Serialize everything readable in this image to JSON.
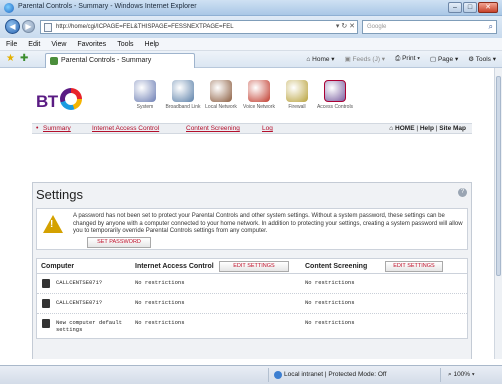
{
  "window": {
    "title": "Parental Controls - Summary - Windows Internet Explorer"
  },
  "addressbar": {
    "url": "http://home/cgi/ICPAGE=FEL&THISPAGE=FESSNEXTPAGE=FEL",
    "search_placeholder": "Google"
  },
  "menubar": [
    "File",
    "Edit",
    "View",
    "Favorites",
    "Tools",
    "Help"
  ],
  "tab": {
    "label": "Parental Controls - Summary"
  },
  "commandbar": {
    "home": "Home",
    "feeds": "Feeds (J)",
    "print": "Print",
    "page": "Page",
    "tools": "Tools"
  },
  "page": {
    "logo": "BT",
    "nav_icons": [
      {
        "label": "System",
        "color": "#6b7db3"
      },
      {
        "label": "Broadband Link",
        "color": "#5a7fa8"
      },
      {
        "label": "Local Network",
        "color": "#8a5b3d"
      },
      {
        "label": "Voice Network",
        "color": "#c0392b"
      },
      {
        "label": "Firewall",
        "color": "#b8a13a"
      },
      {
        "label": "Access Controls",
        "color": "#7a5fa0"
      }
    ],
    "subnav": {
      "links": [
        "Summary",
        "Internet Access Control",
        "Content Screening",
        "Log"
      ],
      "right_home": "HOME",
      "right_help": "Help",
      "right_sitemap": "Site Map"
    },
    "settings": {
      "title": "Settings",
      "warning": "A password has not been set to protect your Parental Controls and other system settings. Without a system password, these settings can be changed by anyone with a computer connected to your home network. In addition to protecting your settings, creating a system password will allow you to temporarily override Parental Controls settings from any computer.",
      "set_password_button": "SET PASSWORD"
    },
    "table": {
      "headers": {
        "computer": "Computer",
        "iac": "Internet Access Control",
        "cs": "Content Screening",
        "edit_iac": "EDIT SETTINGS",
        "edit_cs": "EDIT SETTINGS"
      },
      "rows": [
        {
          "computer": "CALLCENTSE071?",
          "iac": "No restrictions",
          "cs": "No restrictions"
        },
        {
          "computer": "CALLCENTSE071?",
          "iac": "No restrictions",
          "cs": "No restrictions"
        },
        {
          "computer": "New computer default settings",
          "iac": "No restrictions",
          "cs": "No restrictions"
        }
      ]
    }
  },
  "statusbar": {
    "zone": "Local intranet | Protected Mode: Off",
    "zoom": "100%"
  },
  "colors": {
    "accent_red": "#b3102c",
    "bt_purple": "#5a1b83"
  }
}
